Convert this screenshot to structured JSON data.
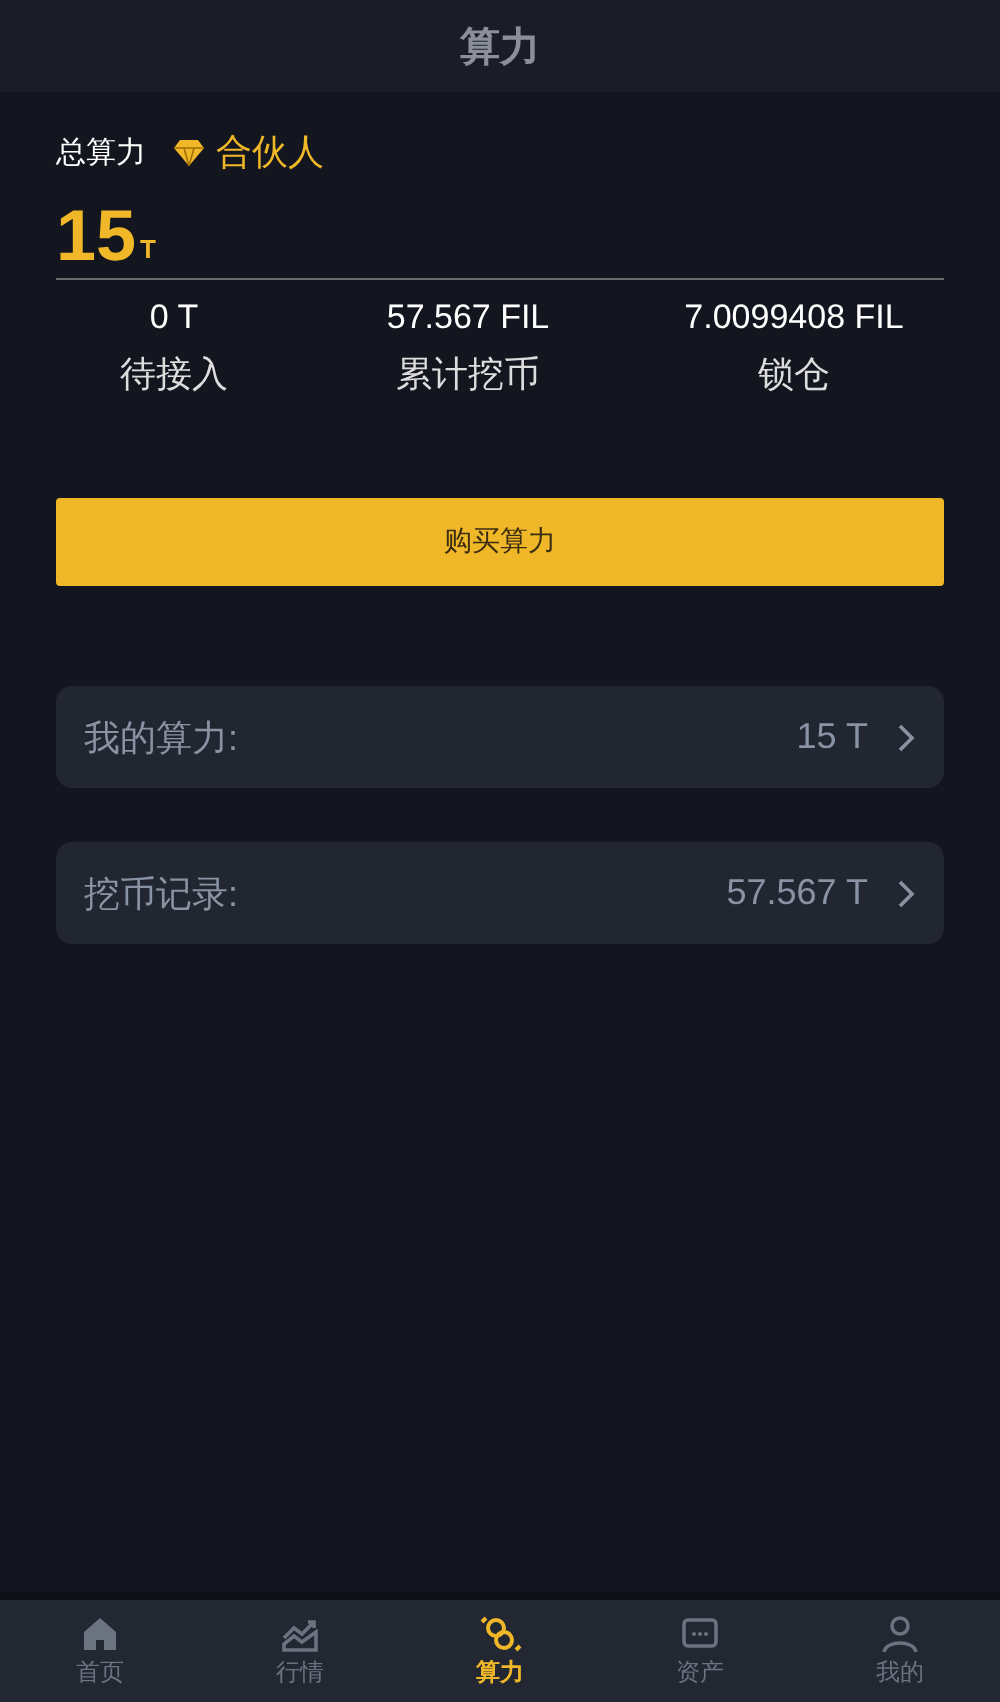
{
  "header": {
    "title": "算力"
  },
  "summary": {
    "label": "总算力",
    "badge": "合伙人",
    "value": "15",
    "unit": "T"
  },
  "stats": [
    {
      "value": "0 T",
      "label": "待接入"
    },
    {
      "value": "57.567 FIL",
      "label": "累计挖币"
    },
    {
      "value": "7.0099408 FIL",
      "label": "锁仓"
    }
  ],
  "buy_button": "购买算力",
  "rows": [
    {
      "label": "我的算力:",
      "value": "15 T"
    },
    {
      "label": "挖币记录:",
      "value": "57.567 T"
    }
  ],
  "tabs": [
    {
      "kind": "home",
      "label": "首页",
      "selected": false
    },
    {
      "kind": "market",
      "label": "行情",
      "selected": false
    },
    {
      "kind": "power",
      "label": "算力",
      "selected": true
    },
    {
      "kind": "assets",
      "label": "资产",
      "selected": false
    },
    {
      "kind": "profile",
      "label": "我的",
      "selected": false
    }
  ]
}
